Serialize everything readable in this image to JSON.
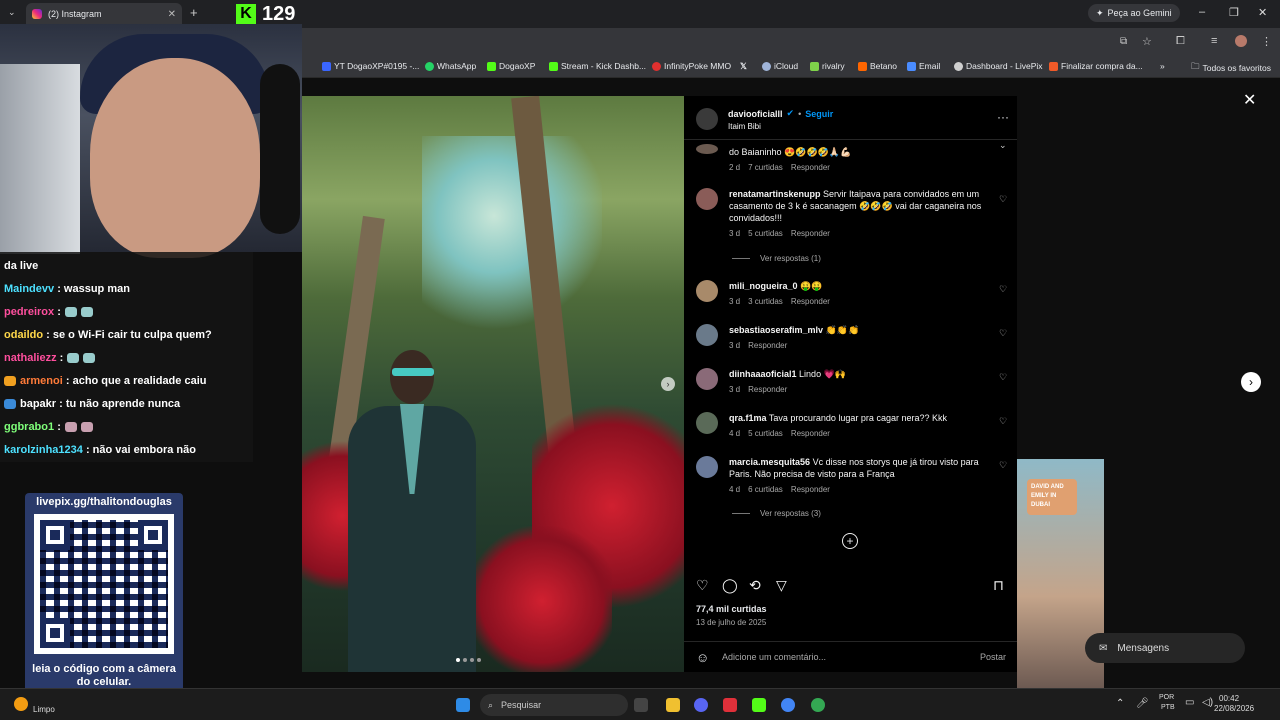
{
  "browser": {
    "tab_title": "(2) Instagram",
    "gemini_button": "Peça ao Gemini",
    "bookmarks": [
      {
        "label": "YT DogaoXP#0195 -...",
        "color": "#3a66ff"
      },
      {
        "label": "WhatsApp",
        "color": "#25d366"
      },
      {
        "label": "DogaoXP",
        "color": "#53fc18"
      },
      {
        "label": "Stream - Kick Dashb...",
        "color": "#53fc18"
      },
      {
        "label": "InfinityPoke MMO",
        "color": "#e0302f"
      },
      {
        "label": "",
        "color": "#ffffff"
      },
      {
        "label": "iCloud",
        "color": "#9fb4d8"
      },
      {
        "label": "rivalry",
        "color": "#7fd34a"
      },
      {
        "label": "Betano",
        "color": "#ff6600"
      },
      {
        "label": "Email",
        "color": "#4a8cff"
      },
      {
        "label": "Dashboard - LivePix",
        "color": "#cfcfcf"
      },
      {
        "label": "Finalizar compra da...",
        "color": "#f05a28"
      }
    ],
    "all_favorites": "Todos os favoritos"
  },
  "stream": {
    "kick_count": "129",
    "chat": [
      {
        "user": "",
        "text": "da live",
        "color": "#ffffff"
      },
      {
        "user": "Maindevv",
        "text": ": wassup man",
        "color": "#4de1ff"
      },
      {
        "user": "pedreirox",
        "text": ":",
        "color": "#ff4f9e"
      },
      {
        "user": "odaildo",
        "text": ": se o Wi-Fi cair tu culpa quem?",
        "color": "#ffd84a"
      },
      {
        "user": "nathaliezz",
        "text": ":",
        "color": "#ff4f9e"
      },
      {
        "user": "armenoi",
        "text": ": acho que a realidade caiu",
        "color": "#ff7b39"
      },
      {
        "user": "bapakr",
        "text": ": tu não aprende nunca",
        "color": "#ffffff"
      },
      {
        "user": "ggbrabo1",
        "text": ":",
        "color": "#7fff7a"
      },
      {
        "user": "karolzinha1234",
        "text": ": não vai embora não",
        "color": "#4de1ff"
      }
    ],
    "qr_header": "livepix.gg/thalitondouglas",
    "qr_footer": "leia o código com a câmera do celular."
  },
  "post": {
    "username": "daviooficialll",
    "follow": "Seguir",
    "location": "Itaim Bibi",
    "comments": [
      {
        "user": "",
        "text": "do Baianinho 😍🤣🤣🤣🙏🏻💪🏻",
        "time": "2 d",
        "likes": "7 curtidas",
        "reply": "Responder",
        "avatar": "#6b5a50"
      },
      {
        "user": "renatamartinskenupp",
        "text": "Servir Itaipava para convidados em um casamento de 3 k é sacanagem 🤣🤣🤣 vai dar caganeira nos convidados!!!",
        "time": "3 d",
        "likes": "5 curtidas",
        "reply": "Responder",
        "avatar": "#8a5c58"
      },
      {
        "user": "mili_nogueira_0",
        "text": "🤑🤑",
        "time": "3 d",
        "likes": "3 curtidas",
        "reply": "Responder",
        "avatar": "#a88a6a"
      },
      {
        "user": "sebastiaoserafim_mlv",
        "text": "👏👏👏",
        "time": "3 d",
        "likes": "",
        "reply": "Responder",
        "avatar": "#6a7a8a"
      },
      {
        "user": "diinhaaaoficial1",
        "text": "Lindo 💗🙌",
        "time": "3 d",
        "likes": "",
        "reply": "Responder",
        "avatar": "#8a6a78"
      },
      {
        "user": "qra.f1ma",
        "text": "Tava procurando lugar pra cagar nera?? Kkk",
        "time": "4 d",
        "likes": "5 curtidas",
        "reply": "Responder",
        "avatar": "#5a6a58"
      },
      {
        "user": "marcia.mesquita56",
        "text": "Vc disse nos storys que já tirou visto para Paris. Não precisa de visto para a França",
        "time": "4 d",
        "likes": "6 curtidas",
        "reply": "Responder",
        "avatar": "#6a7a9a"
      }
    ],
    "view_replies_1": "Ver respostas (1)",
    "view_replies_2": "Ver respostas (3)",
    "like_count": "77,4 mil curtidas",
    "date": "13 de julho de 2025",
    "comment_placeholder": "Adicione um comentário...",
    "post_button": "Postar"
  },
  "overlay": {
    "messages": "Mensagens",
    "next_thumb_text": "DAVID AND EMILY IN DUBAI"
  },
  "taskbar": {
    "weather": "Limpo",
    "search_placeholder": "Pesquisar",
    "lang": "POR",
    "lang2": "PTB",
    "time": "00:42",
    "date": "22/08/2026"
  }
}
